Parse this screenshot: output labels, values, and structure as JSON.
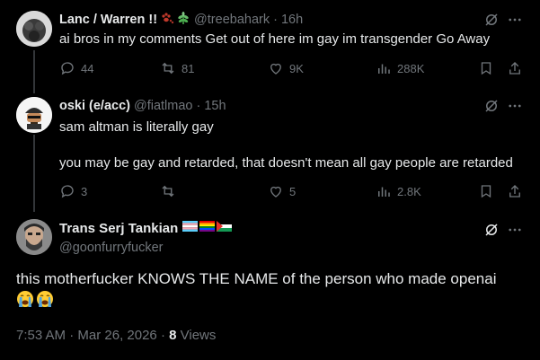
{
  "posts": [
    {
      "name": "Lanc / Warren !!",
      "handle": "@treebahark",
      "time": "16h",
      "text": "ai bros in my comments Get out of here im gay im transgender Go Away",
      "replies": "44",
      "reposts": "81",
      "likes": "9K",
      "views": "288K",
      "flair_icons": [
        "paw-prints-icon",
        "herb-icon"
      ]
    },
    {
      "name": "oski (e/acc)",
      "handle": "@fiatlmao",
      "time": "15h",
      "text": "sam altman is literally gay\n\nyou may be gay and retarded, that doesn't mean all gay people are retarded",
      "replies": "3",
      "reposts": "",
      "likes": "5",
      "views": "2.8K"
    }
  ],
  "main_post": {
    "name": "Trans Serj Tankian",
    "handle": "@goonfurryfucker",
    "flags": [
      "transgender-flag-icon",
      "rainbow-flag-icon",
      "palestine-flag-icon"
    ],
    "text": "this motherfucker KNOWS THE NAME of the person who made openai",
    "emoji": [
      "loudly-crying-face-icon",
      "loudly-crying-face-icon"
    ],
    "time": "7:53 AM",
    "date": "Mar 26, 2026",
    "views_count": "8",
    "views_label": "Views",
    "separator": "·"
  },
  "colors": {
    "background": "#000000",
    "text": "#e7e9ea",
    "muted": "#71767b",
    "thread_line": "#333639"
  }
}
